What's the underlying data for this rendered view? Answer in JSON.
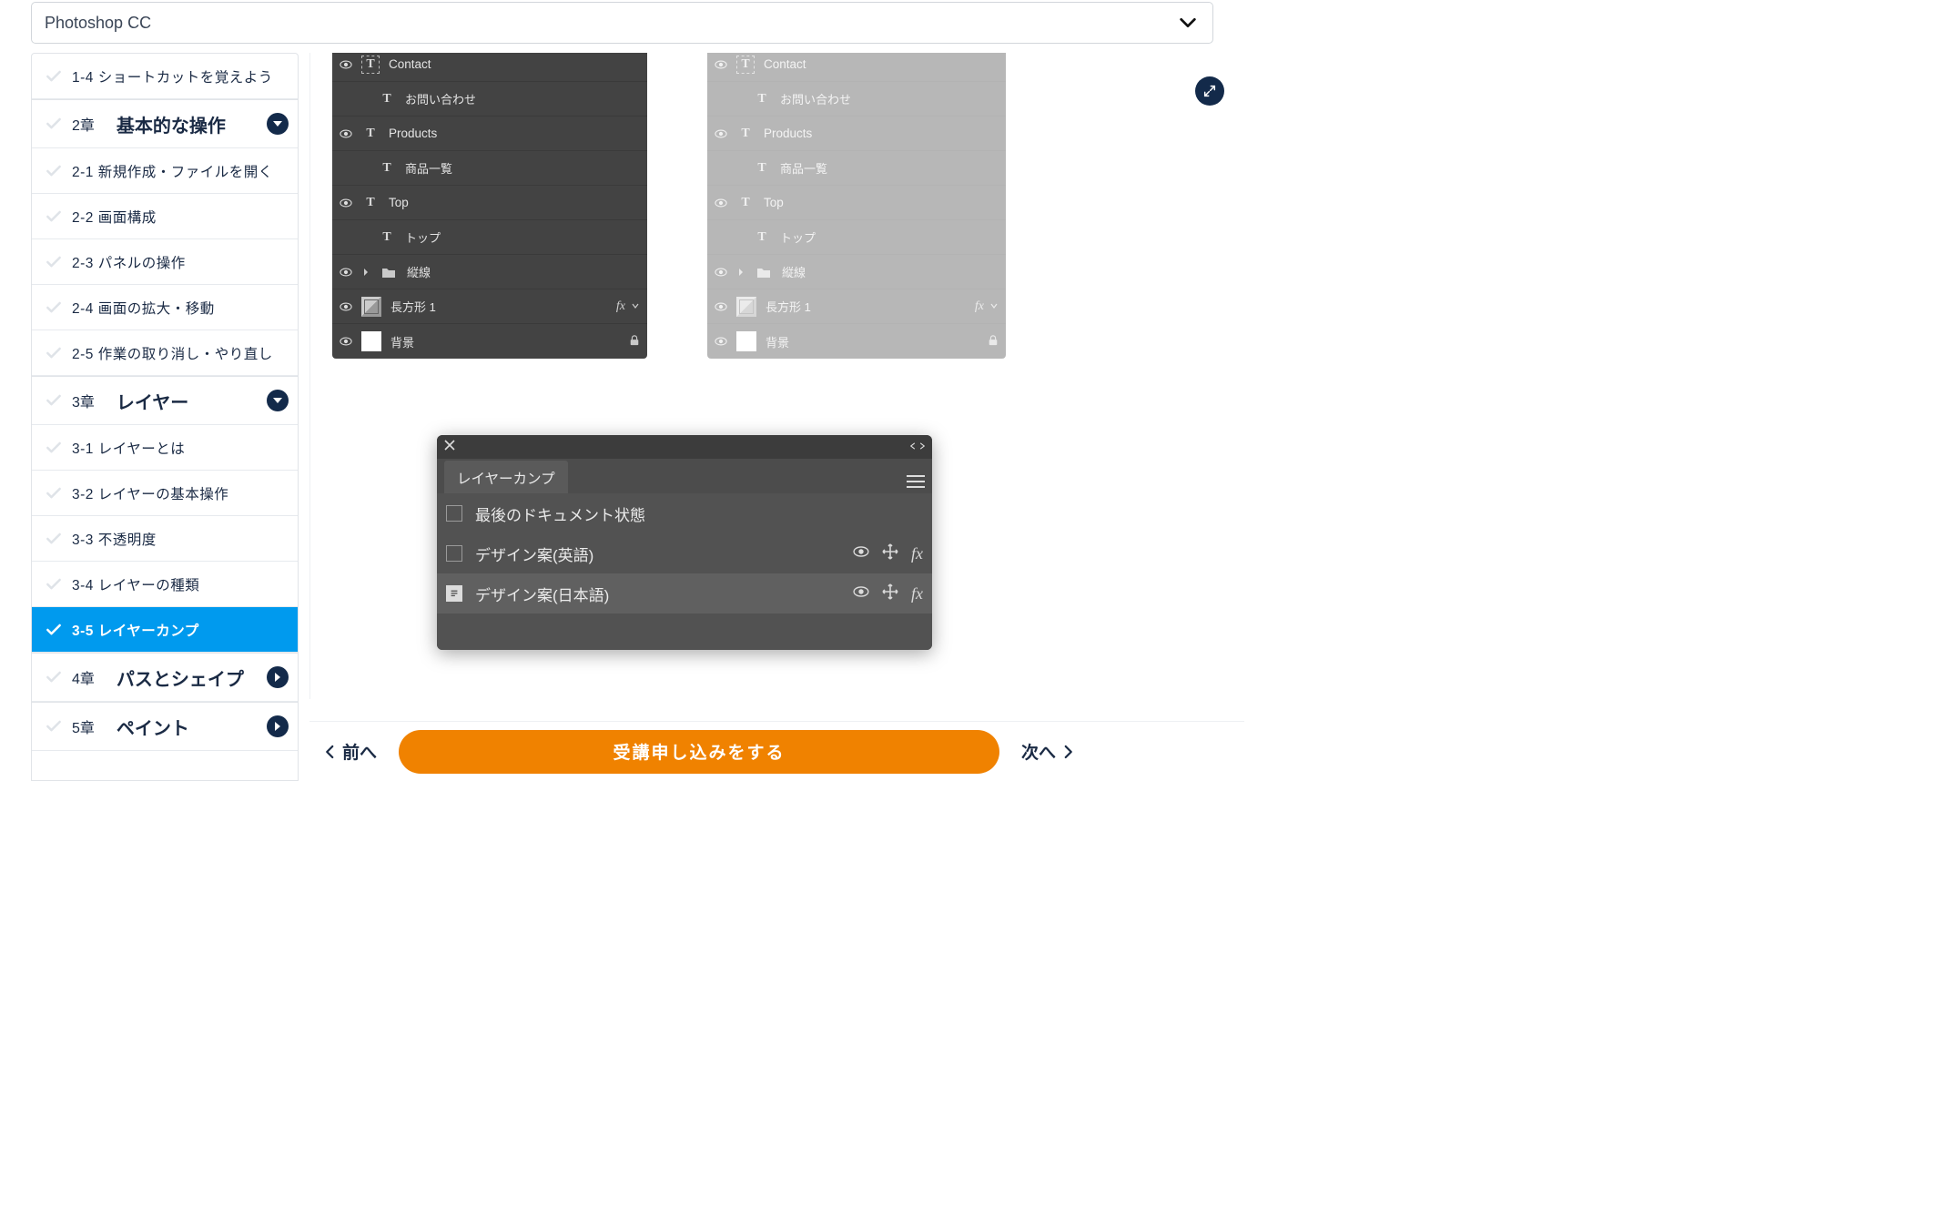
{
  "topbar": {
    "course_label": "Photoshop CC"
  },
  "sidebar": {
    "pre_item": "1-4 ショートカットを覚えよう",
    "chapters": [
      {
        "num": "2章",
        "title": "基本的な操作",
        "expanded": true,
        "lessons": [
          "2-1 新規作成・ファイルを開く",
          "2-2 画面構成",
          "2-3 パネルの操作",
          "2-4 画面の拡大・移動",
          "2-5 作業の取り消し・やり直し"
        ]
      },
      {
        "num": "3章",
        "title": "レイヤー",
        "expanded": true,
        "lessons": [
          "3-1 レイヤーとは",
          "3-2 レイヤーの基本操作",
          "3-3 不透明度",
          "3-4 レイヤーの種類",
          "3-5 レイヤーカンプ"
        ],
        "active_index": 4
      },
      {
        "num": "4章",
        "title": "パスとシェイプ",
        "expanded": false
      },
      {
        "num": "5章",
        "title": "ペイント",
        "expanded": false
      }
    ]
  },
  "layers_panel": {
    "rows": [
      {
        "eye": true,
        "kind": "T",
        "kind_sel": true,
        "name": "Contact"
      },
      {
        "eye": false,
        "kind": "T",
        "indent": true,
        "name": "お問い合わせ",
        "jp": true
      },
      {
        "eye": true,
        "kind": "T",
        "name": "Products"
      },
      {
        "eye": false,
        "kind": "T",
        "indent": true,
        "name": "商品一覧",
        "jp": true
      },
      {
        "eye": true,
        "kind": "T",
        "name": "Top"
      },
      {
        "eye": false,
        "kind": "T",
        "indent": true,
        "name": "トップ",
        "jp": true
      },
      {
        "eye": true,
        "kind": "grp",
        "arrow": true,
        "name": "縦線",
        "jp": true
      },
      {
        "eye": true,
        "kind": "shape",
        "name": "長方形 1",
        "jp": true,
        "fx": true
      },
      {
        "eye": true,
        "kind": "bg",
        "name": "背景",
        "jp": true,
        "lock": true
      }
    ]
  },
  "layer_comps_panel": {
    "tab": "レイヤーカンプ",
    "rows": [
      {
        "label": "最後のドキュメント状態",
        "icons": false,
        "sel": false,
        "checked": false
      },
      {
        "label": "デザイン案(英語)",
        "icons": true,
        "sel": false,
        "checked": false
      },
      {
        "label": "デザイン案(日本語)",
        "icons": true,
        "sel": true,
        "checked": true
      }
    ]
  },
  "bottombar": {
    "prev": "前へ",
    "next": "次へ",
    "cta": "受講申し込みをする"
  }
}
